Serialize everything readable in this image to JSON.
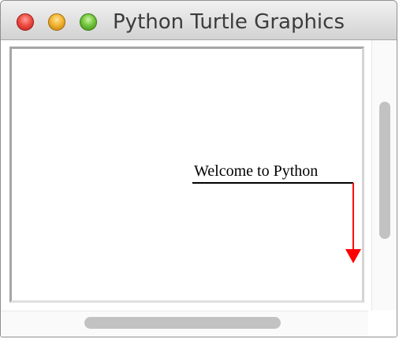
{
  "window": {
    "title": "Python Turtle Graphics",
    "controls": {
      "close": "close-button",
      "minimize": "minimize-button",
      "zoom": "zoom-button"
    }
  },
  "canvas": {
    "text": "Welcome to Python",
    "pen_color": "#ff0000",
    "text_color": "#000000",
    "background": "#ffffff"
  },
  "scrollbars": {
    "vertical": "vertical-scrollbar",
    "horizontal": "horizontal-scrollbar"
  }
}
